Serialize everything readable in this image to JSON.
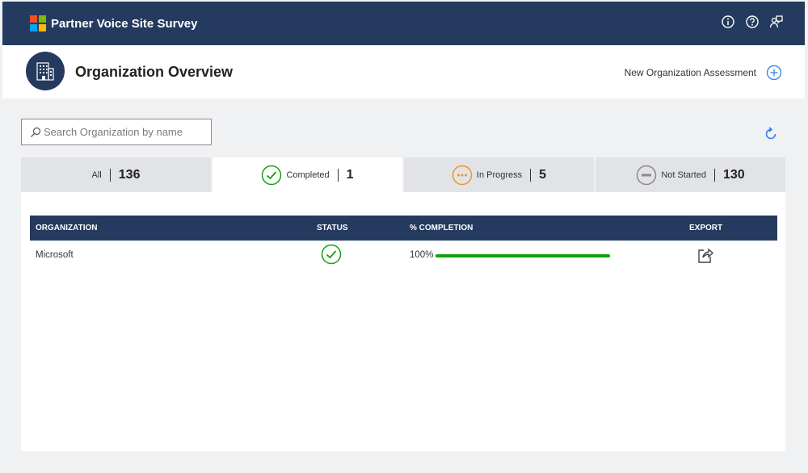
{
  "app": {
    "title": "Partner Voice Site Survey"
  },
  "topbar_icons": [
    "info-icon",
    "help-icon",
    "feedback-icon"
  ],
  "header": {
    "title": "Organization Overview",
    "new_assessment_label": "New Organization Assessment"
  },
  "search": {
    "placeholder": "Search Organization by name"
  },
  "tabs": [
    {
      "label": "All",
      "count": "136",
      "icon": "none"
    },
    {
      "label": "Completed",
      "count": "1",
      "icon": "check-circle-icon"
    },
    {
      "label": "In Progress",
      "count": "5",
      "icon": "ellipsis-circle-icon"
    },
    {
      "label": "Not Started",
      "count": "130",
      "icon": "minus-circle-icon"
    }
  ],
  "active_tab": "Completed",
  "table": {
    "columns": [
      "ORGANIZATION",
      "STATUS",
      "% COMPLETION",
      "EXPORT"
    ],
    "rows": [
      {
        "organization": "Microsoft",
        "status": "Completed",
        "completion_label": "100%",
        "completion": 1.0
      }
    ]
  },
  "colors": {
    "navy": "#243a5e",
    "green": "#13a10e",
    "orange": "#f7931e",
    "gray": "#8a8a8a",
    "blue": "#2f80ed"
  }
}
